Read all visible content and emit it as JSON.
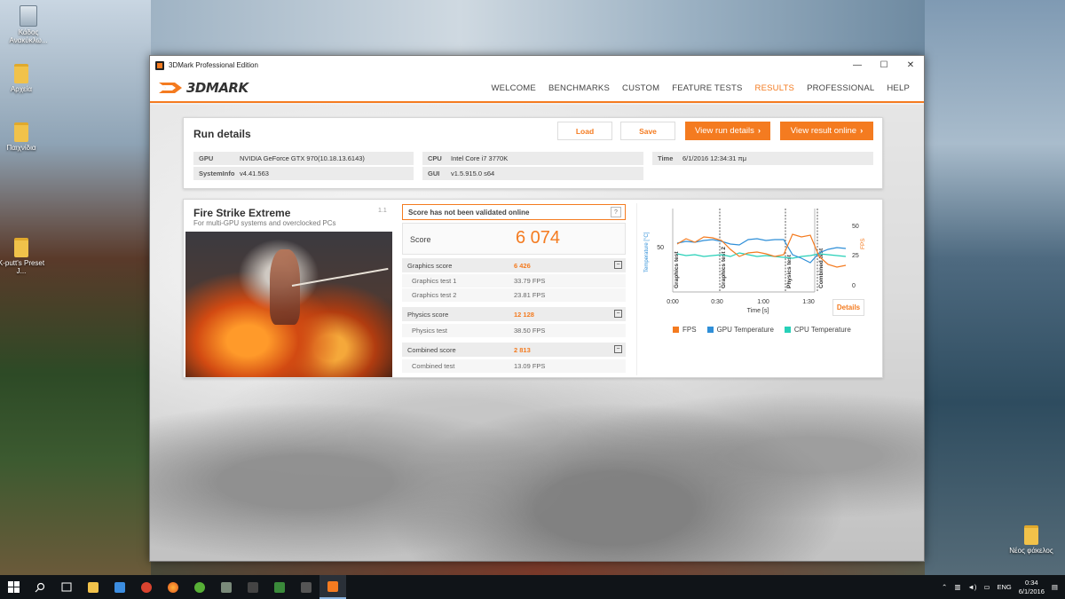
{
  "desktop": {
    "icons": [
      {
        "label": "Κάδος Ανακύκλω..."
      },
      {
        "label": "Αρχεία"
      },
      {
        "label": "Παιχνίδια"
      },
      {
        "label": "K-putt's Preset J..."
      },
      {
        "label": "Νέος φάκελος"
      }
    ]
  },
  "window": {
    "title": "3DMark Professional Edition",
    "controls": {
      "minimize": "—",
      "maximize": "☐",
      "close": "✕"
    }
  },
  "nav": {
    "logo": "3DMARK",
    "items": [
      "WELCOME",
      "BENCHMARKS",
      "CUSTOM",
      "FEATURE TESTS",
      "RESULTS",
      "PROFESSIONAL",
      "HELP"
    ],
    "active": "RESULTS"
  },
  "run_details": {
    "title": "Run details",
    "load_label": "Load",
    "save_label": "Save",
    "view_run_label": "View run details",
    "view_online_label": "View result online",
    "gpu_key": "GPU",
    "gpu_value": "NVIDIA GeForce GTX 970(10.18.13.6143)",
    "systeminfo_key": "SystemInfo",
    "systeminfo_value": "v4.41.563",
    "cpu_key": "CPU",
    "cpu_value": "Intel Core i7 3770K",
    "gui_key": "GUI",
    "gui_value": "v1.5.915.0 s64",
    "time_key": "Time",
    "time_value": "6/1/2016 12:34:31 πμ"
  },
  "result": {
    "test_name": "Fire Strike Extreme",
    "test_sub": "For multi-GPU systems and overclocked PCs",
    "version": "1.1",
    "validation": "Score has not been validated online",
    "help": "?",
    "score_label": "Score",
    "score_value": "6 074",
    "graphics_label": "Graphics score",
    "graphics_value": "6 426",
    "gt1_label": "Graphics test 1",
    "gt1_value": "33.79 FPS",
    "gt2_label": "Graphics test 2",
    "gt2_value": "23.81 FPS",
    "physics_label": "Physics score",
    "physics_value": "12 128",
    "pt_label": "Physics test",
    "pt_value": "38.50 FPS",
    "combined_label": "Combined score",
    "combined_value": "2 813",
    "ct_label": "Combined test",
    "ct_value": "13.09 FPS",
    "collapse_glyph": "−"
  },
  "chart": {
    "details_label": "Details",
    "x_ticks": [
      "0:00",
      "0:30",
      "1:00",
      "1:30"
    ],
    "x_label": "Time [s]",
    "y_left_label": "Temperature [°C]",
    "y_left_tick": "50",
    "y_right_label": "FPS",
    "y_right_ticks": [
      "50",
      "25",
      "0"
    ],
    "markers": [
      "Graphics test",
      "Graphics test 2",
      "Physics test",
      "Combined test"
    ],
    "legend": [
      {
        "name": "FPS",
        "color": "#f47b20"
      },
      {
        "name": "GPU Temperature",
        "color": "#2f8fd8"
      },
      {
        "name": "CPU Temperature",
        "color": "#27d0b8"
      }
    ]
  },
  "taskbar": {
    "language": "ENG",
    "time": "0:34",
    "date": "6/1/2016"
  },
  "colors": {
    "accent": "#f47b20"
  }
}
